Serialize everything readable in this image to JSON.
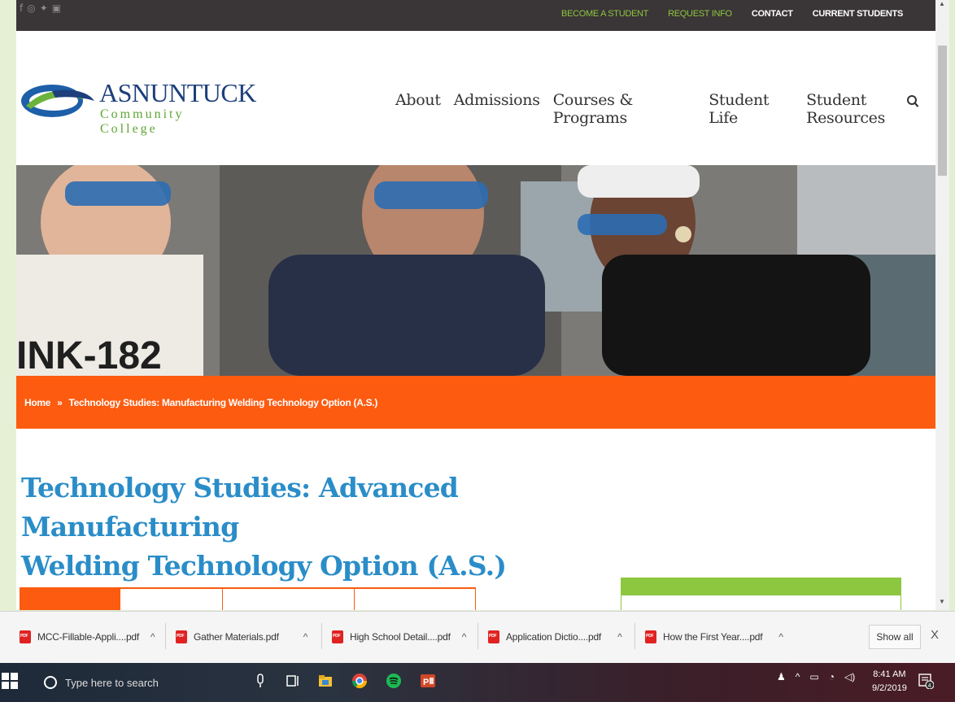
{
  "social": {
    "icons": [
      "facebook-icon",
      "instagram-icon",
      "twitter-icon",
      "youtube-icon"
    ],
    "glyphs": [
      "f",
      "◎",
      "✦",
      "▣"
    ]
  },
  "utility_links": {
    "become_student": "BECOME A STUDENT",
    "request_info": "REQUEST INFO",
    "contact": "CONTACT",
    "current_students": "CURRENT STUDENTS"
  },
  "logo": {
    "title": "ASNUNTUCK",
    "subtitle": "Community College"
  },
  "nav": {
    "items": [
      "About",
      "Admissions",
      "Courses & Programs",
      "Student Life",
      "Student Resources"
    ]
  },
  "breadcrumb": {
    "home": "Home",
    "separator": "»",
    "current": "Technology Studies: Manufacturing Welding Technology Option (A.S.)"
  },
  "page": {
    "title_line1": "Technology Studies: Advanced Manufacturing",
    "title_line2": "Welding Technology Option (A.S.)"
  },
  "downloads": {
    "items": [
      "MCC-Fillable-Appli....pdf",
      "Gather Materials.pdf",
      "High School Detail....pdf",
      "Application Dictio....pdf",
      "How the First Year....pdf"
    ],
    "caret": "^",
    "show_all": "Show all",
    "close": "X"
  },
  "taskbar": {
    "search_placeholder": "Type here to search",
    "time": "8:41 AM",
    "date": "9/2/2019",
    "notifications": "4"
  },
  "colors": {
    "orange": "#fc5b10",
    "green": "#8dc63f",
    "blue_title": "#2a8dc8",
    "dark_bar": "#3a3536"
  }
}
